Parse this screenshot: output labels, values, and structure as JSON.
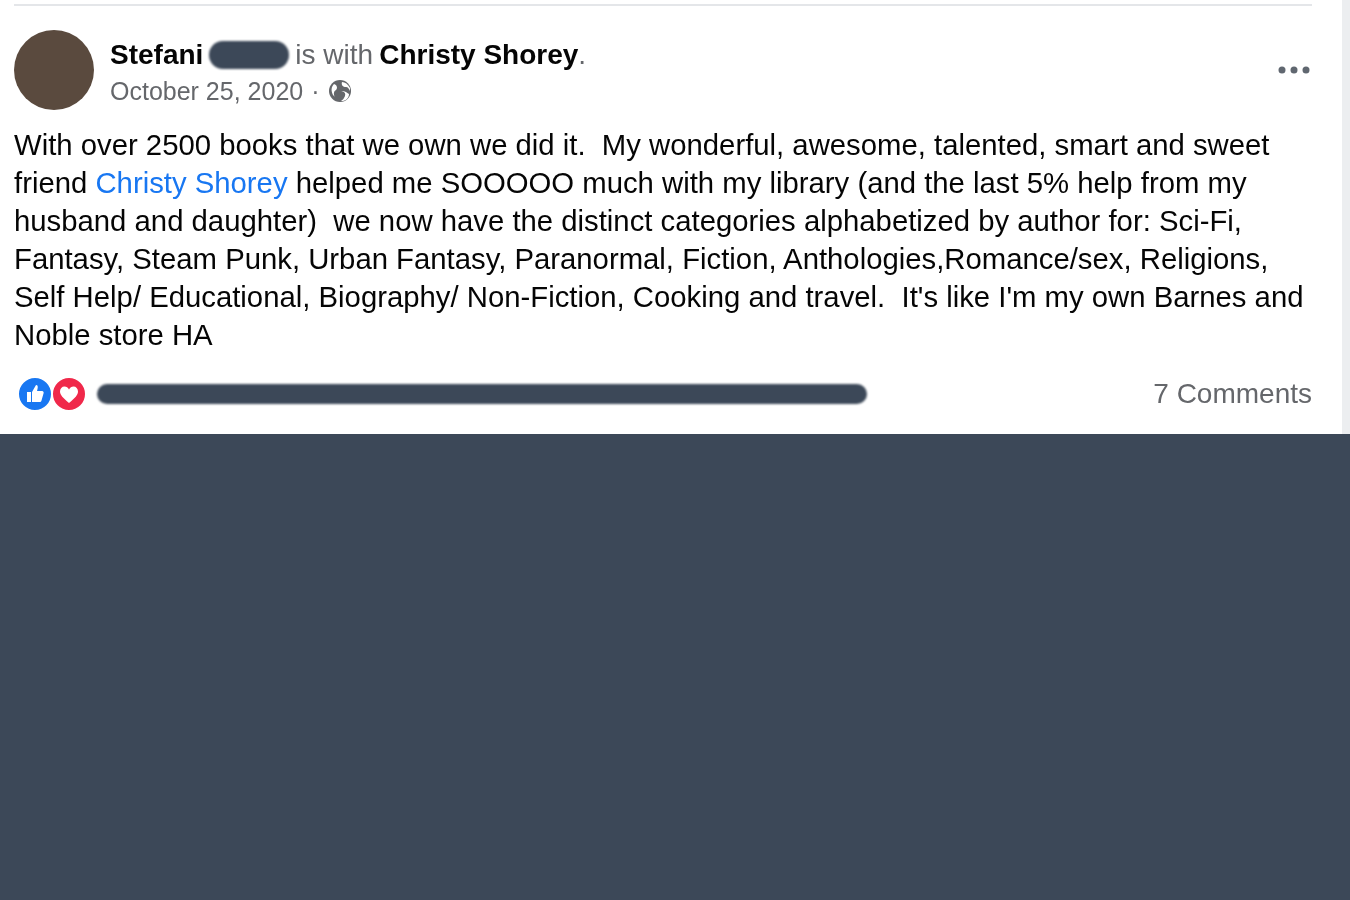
{
  "post": {
    "author": "Stefani",
    "with_text": "is with",
    "tagged": "Christy Shorey",
    "tagged_suffix": ".",
    "date": "October 25, 2020",
    "separator": "·",
    "body": {
      "before": "With over 2500 books that we own we did it.  My wonderful, awesome, talented, smart and sweet friend ",
      "link": "Christy Shorey",
      "after": " helped me SOOOOO much with my library (and the last 5% help from my husband and daughter)  we now have the distinct categories alphabetized by author for: Sci-Fi, Fantasy, Steam Punk, Urban Fantasy, Paranormal, Fiction, Anthologies,Romance/sex, Religions, Self Help/ Educational, Biography/ Non-Fiction, Cooking and travel.  It's like I'm my own Barnes and Noble store HA"
    },
    "reactions": [
      {
        "kind": "like"
      },
      {
        "kind": "love"
      }
    ],
    "comments": "7 Comments"
  }
}
